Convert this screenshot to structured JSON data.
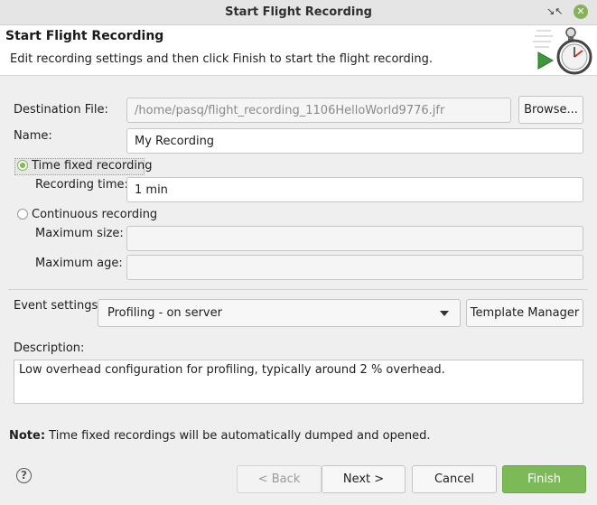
{
  "window": {
    "title": "Start Flight Recording",
    "restore_icon": "restore-icon",
    "close_icon": "close-icon"
  },
  "header": {
    "title": "Start Flight Recording",
    "description": "Edit recording settings and then click Finish to start the flight recording.",
    "logo_icon": "stopwatch-record-icon"
  },
  "form": {
    "destination_label": "Destination File:",
    "destination_value": "/home/pasq/flight_recording_1106HelloWorld9776.jfr",
    "browse_label": "Browse...",
    "name_label": "Name:",
    "name_value": "My Recording",
    "time_fixed_label": "Time fixed recording",
    "time_fixed_selected": true,
    "recording_time_label": "Recording time:",
    "recording_time_value": "1 min",
    "continuous_label": "Continuous recording",
    "continuous_selected": false,
    "max_size_label": "Maximum size:",
    "max_size_value": "",
    "max_age_label": "Maximum age:",
    "max_age_value": "",
    "event_settings_label": "Event settings:",
    "event_settings_value": "Profiling - on server",
    "template_manager_label": "Template Manager",
    "description_label": "Description:",
    "description_value": "Low overhead configuration for profiling, typically around 2 % overhead."
  },
  "note": {
    "bold": "Note:",
    "text": " Time fixed recordings will be automatically dumped and opened."
  },
  "footer": {
    "help_icon": "help-icon",
    "help_glyph": "?",
    "back_label": "< Back",
    "next_label": "Next >",
    "cancel_label": "Cancel",
    "finish_label": "Finish"
  },
  "colors": {
    "accent": "#7cba58",
    "titlebar_close": "#87b158"
  }
}
